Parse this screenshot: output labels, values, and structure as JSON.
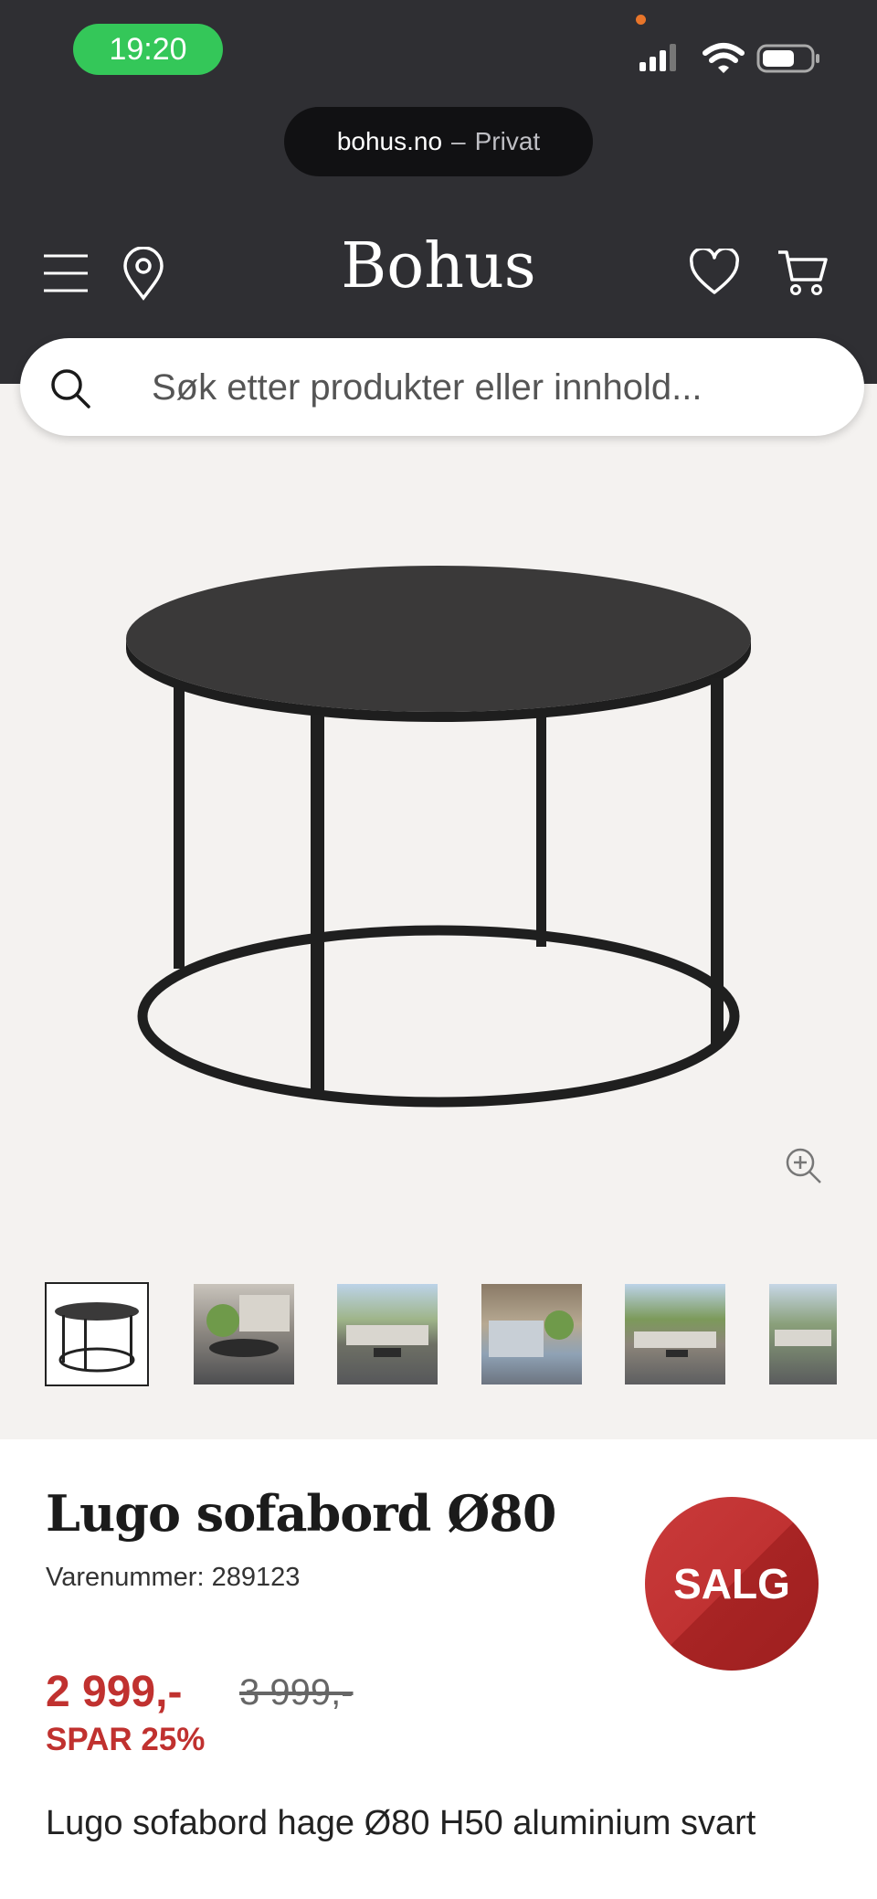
{
  "status_bar": {
    "time": "19:20",
    "icons": [
      "signal-icon",
      "wifi-icon",
      "battery-icon"
    ]
  },
  "browser": {
    "domain": "bohus.no",
    "separator": "–",
    "mode": "Privat"
  },
  "header": {
    "brand": "Bohus",
    "icons": [
      "menu-icon",
      "location-pin-icon",
      "heart-icon",
      "cart-icon"
    ]
  },
  "search": {
    "placeholder": "Søk etter produkter eller innhold..."
  },
  "gallery": {
    "thumbnail_count": 6,
    "selected_index": 0,
    "zoom_icon": "zoom-in-icon"
  },
  "product": {
    "title": "Lugo sofabord Ø80",
    "sku": "Varenummer: 289123",
    "badge": "SALG",
    "price": "2 999,-",
    "old_price": "3 999,-",
    "savings": "SPAR 25%",
    "description": "Lugo sofabord hage Ø80 H50 aluminium svart"
  },
  "colors": {
    "header_bg": "#2f2f33",
    "sale_red": "#c0312f",
    "time_pill": "#34c759",
    "hero_bg": "#f4f2f0"
  }
}
